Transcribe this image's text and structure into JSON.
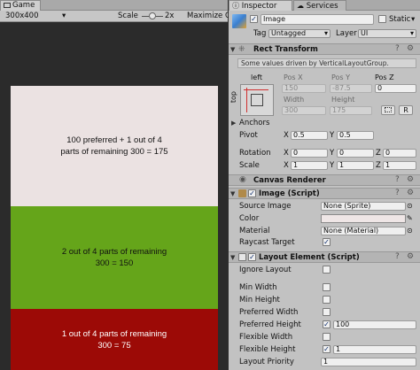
{
  "game": {
    "tab_label": "Game",
    "resolution": "300x400",
    "scale_label": "Scale",
    "scale_value": "2x",
    "maximize_label": "Maximize O",
    "slider_value": 0.5,
    "blocks": [
      {
        "text_line1": "100 preferred + 1 out of 4",
        "text_line2": "parts of remaining 300 = 175",
        "color": "#ebe2e2"
      },
      {
        "text_line1": "2 out of 4 parts of remaining",
        "text_line2": "300 = 150",
        "color": "#65a51a"
      },
      {
        "text_line1": "1 out of 4 parts of remaining",
        "text_line2": "300 = 75",
        "color": "#9c0a06"
      }
    ]
  },
  "inspector": {
    "tab_label": "Inspector",
    "services_tab_label": "Services",
    "object_name": "Image",
    "static_label": "Static",
    "tag_label": "Tag",
    "tag_value": "Untagged",
    "layer_label": "Layer",
    "layer_value": "UI",
    "rect_transform": {
      "title": "Rect Transform",
      "info": "Some values driven by VerticalLayoutGroup.",
      "anchor_h_label": "left",
      "anchor_v_label": "top",
      "pos_x_label": "Pos X",
      "pos_y_label": "Pos Y",
      "pos_z_label": "Pos Z",
      "pos_x": "150",
      "pos_y": "-87.5",
      "pos_z": "0",
      "width_label": "Width",
      "height_label": "Height",
      "width": "300",
      "height": "175",
      "blueprint_btn": "",
      "raw_btn": "R",
      "anchors_label": "Anchors",
      "pivot_label": "Pivot",
      "pivot_x": "0.5",
      "pivot_y": "0.5",
      "rotation_label": "Rotation",
      "rot_x": "0",
      "rot_y": "0",
      "rot_z": "0",
      "scale_label": "Scale",
      "scale_x": "1",
      "scale_y": "1",
      "scale_z": "1",
      "axis_x": "X",
      "axis_y": "Y",
      "axis_z": "Z"
    },
    "canvas_renderer": {
      "title": "Canvas Renderer"
    },
    "image_script": {
      "title": "Image (Script)",
      "source_image_label": "Source Image",
      "source_image_value": "None (Sprite)",
      "color_label": "Color",
      "color_value": "#efe6e6",
      "material_label": "Material",
      "material_value": "None (Material)",
      "raycast_label": "Raycast Target"
    },
    "layout_element": {
      "title": "Layout Element (Script)",
      "ignore_layout_label": "Ignore Layout",
      "min_width_label": "Min Width",
      "min_height_label": "Min Height",
      "preferred_width_label": "Preferred Width",
      "preferred_height_label": "Preferred Height",
      "preferred_height_value": "100",
      "flexible_width_label": "Flexible Width",
      "flexible_height_label": "Flexible Height",
      "flexible_height_value": "1",
      "layout_priority_label": "Layout Priority",
      "layout_priority_value": "1"
    }
  },
  "colors": {
    "panel_bg": "#c2c2c2",
    "checkmark": "#0a2a6a",
    "cube_blue": "#3a7fd0"
  }
}
